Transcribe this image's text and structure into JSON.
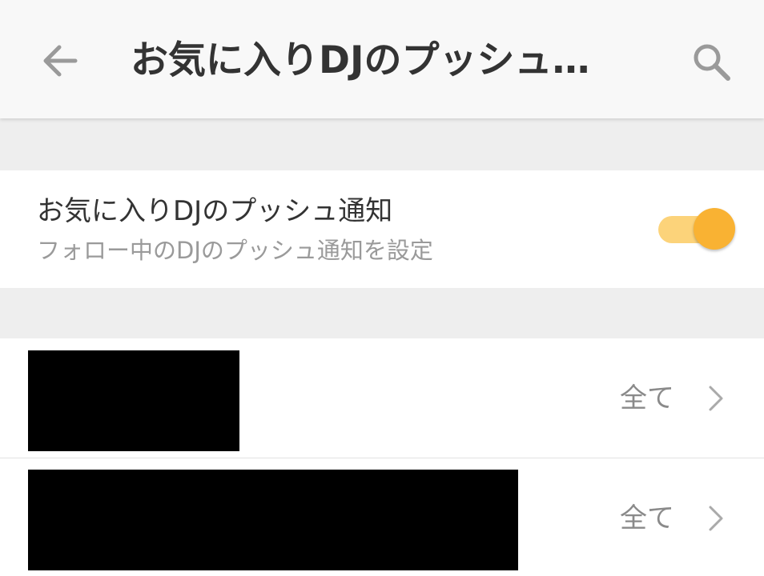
{
  "appbar": {
    "title": "お気に入りDJのプッシュ…",
    "back_icon": "arrow-left-icon",
    "search_icon": "search-icon"
  },
  "push_setting": {
    "title": "お気に入りDJのプッシュ通知",
    "subtitle": "フォロー中のDJのプッシュ通知を設定",
    "enabled": true
  },
  "dj_list": [
    {
      "value": "全て",
      "chevron_icon": "chevron-right-icon"
    },
    {
      "value": "全て",
      "chevron_icon": "chevron-right-icon"
    }
  ],
  "colors": {
    "accent": "#f9b233",
    "accent_track": "#fcd37a",
    "appbar_bg": "#f8f8f8",
    "section_bg": "#eeeeee",
    "title_text": "#333333",
    "secondary_text": "#9a9a9a"
  }
}
